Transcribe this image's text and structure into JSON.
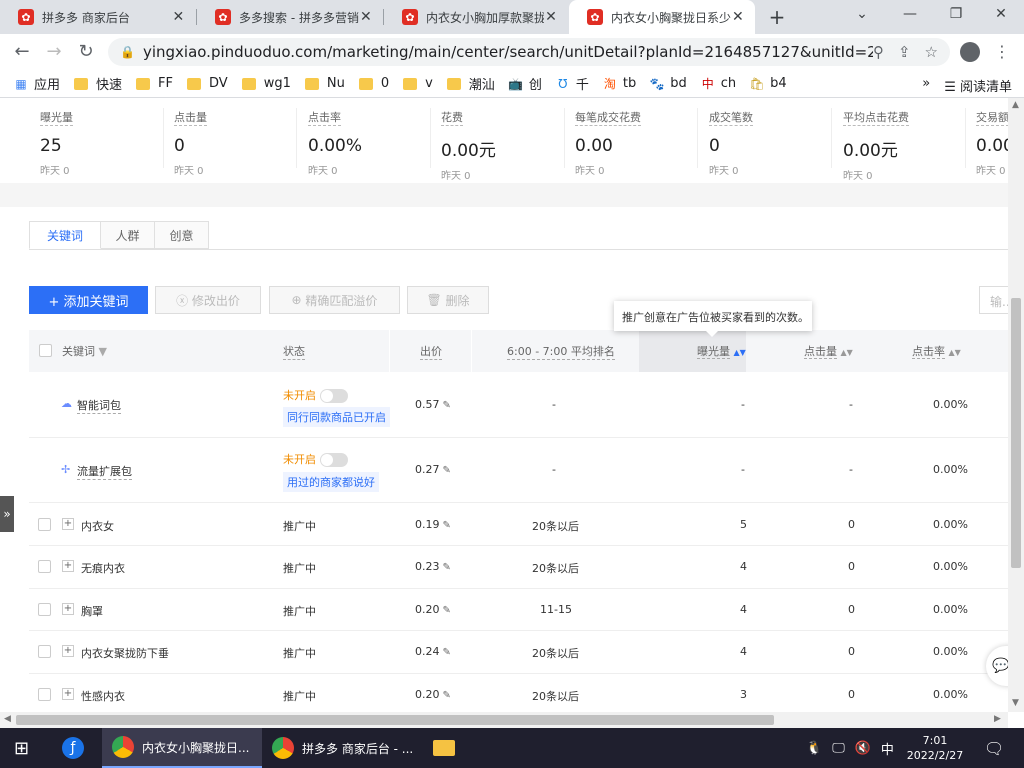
{
  "browser": {
    "tabs": [
      {
        "title": "拼多多 商家后台",
        "active": false
      },
      {
        "title": "多多搜索 - 拼多多营销",
        "active": false
      },
      {
        "title": "内衣女小胸加厚款聚拢",
        "active": false
      },
      {
        "title": "内衣女小胸聚拢日系少",
        "active": true
      }
    ],
    "new_tab": "+",
    "url": "yingxiao.pinduoduo.com/marketing/main/center/search/unitDetail?planId=2164857127&unitId=26492...",
    "bookmarks": [
      "应用",
      "快速",
      "FF",
      "DV",
      "wg1",
      "Nu",
      "0",
      "v",
      "潮汕",
      "创",
      "千",
      "tb",
      "bd",
      "ch",
      "b4"
    ],
    "more_bookmarks": "»",
    "reading_list": "阅读清单"
  },
  "stats": [
    {
      "label": "曝光量",
      "value": "25",
      "yesterday": "昨天 0"
    },
    {
      "label": "点击量",
      "value": "0",
      "yesterday": "昨天 0"
    },
    {
      "label": "点击率",
      "value": "0.00%",
      "yesterday": "昨天 0"
    },
    {
      "label": "花费",
      "value": "0.00元",
      "yesterday": "昨天 0"
    },
    {
      "label": "每笔成交花费",
      "value": "0.00",
      "yesterday": "昨天 0"
    },
    {
      "label": "成交笔数",
      "value": "0",
      "yesterday": "昨天 0"
    },
    {
      "label": "平均点击花费",
      "value": "0.00元",
      "yesterday": "昨天 0"
    },
    {
      "label": "交易额",
      "value": "0.00",
      "yesterday": "昨天 0"
    }
  ],
  "subtabs": [
    "关键词",
    "人群",
    "创意"
  ],
  "actions": {
    "add": "+ 添加关键词",
    "modify": "修改出价",
    "exact": "精确匹配溢价",
    "delete": "删除",
    "search_placeholder": "输..."
  },
  "tooltip": "推广创意在广告位被买家看到的次数。",
  "table": {
    "headers": {
      "keyword": "关键词",
      "status": "状态",
      "bid": "出价",
      "rank": "6:00 - 7:00 平均排名",
      "impressions": "曝光量",
      "clicks": "点击量",
      "ctr": "点击率"
    },
    "special_rows": [
      {
        "name": "智能词包",
        "status": "未开启",
        "tag": "同行同款商品已开启",
        "bid": "0.57",
        "rank": "-",
        "impressions": "-",
        "clicks": "-",
        "ctr": "0.00%"
      },
      {
        "name": "流量扩展包",
        "status": "未开启",
        "tag": "用过的商家都说好",
        "bid": "0.27",
        "rank": "-",
        "impressions": "-",
        "clicks": "-",
        "ctr": "0.00%"
      }
    ],
    "rows": [
      {
        "keyword": "内衣女",
        "status": "推广中",
        "bid": "0.19",
        "rank": "20条以后",
        "impressions": "5",
        "clicks": "0",
        "ctr": "0.00%"
      },
      {
        "keyword": "无痕内衣",
        "status": "推广中",
        "bid": "0.23",
        "rank": "20条以后",
        "impressions": "4",
        "clicks": "0",
        "ctr": "0.00%"
      },
      {
        "keyword": "胸罩",
        "status": "推广中",
        "bid": "0.20",
        "rank": "11-15",
        "impressions": "4",
        "clicks": "0",
        "ctr": "0.00%"
      },
      {
        "keyword": "内衣女聚拢防下垂",
        "status": "推广中",
        "bid": "0.24",
        "rank": "20条以后",
        "impressions": "4",
        "clicks": "0",
        "ctr": "0.00%"
      },
      {
        "keyword": "性感内衣",
        "status": "推广中",
        "bid": "0.20",
        "rank": "20条以后",
        "impressions": "3",
        "clicks": "0",
        "ctr": "0.00%"
      }
    ]
  },
  "taskbar": {
    "items": [
      "内衣女小胸聚拢日...",
      "拼多多 商家后台 - ..."
    ],
    "ime": "中",
    "time": "7:01",
    "date": "2022/2/27"
  }
}
